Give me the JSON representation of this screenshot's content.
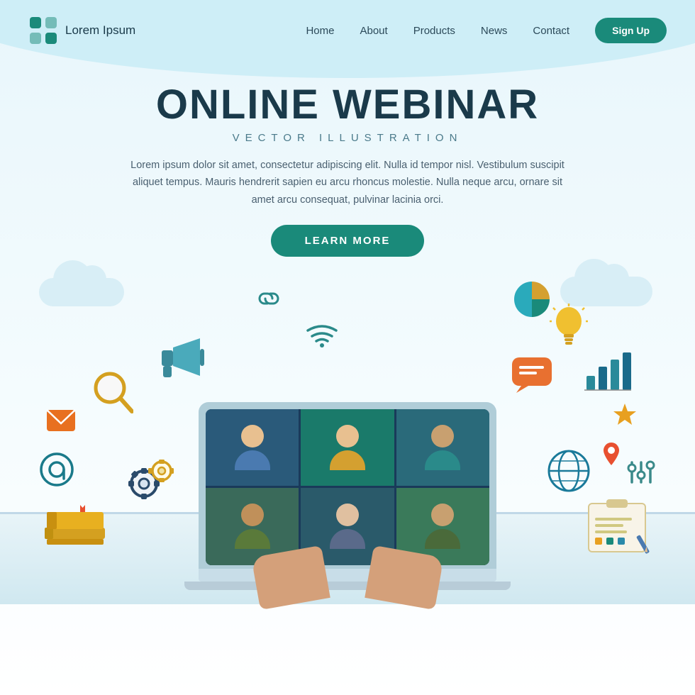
{
  "brand": {
    "logo_text": "Lorem Ipsum"
  },
  "nav": {
    "links": [
      {
        "label": "Home",
        "name": "nav-home"
      },
      {
        "label": "About",
        "name": "nav-about"
      },
      {
        "label": "Products",
        "name": "nav-products"
      },
      {
        "label": "News",
        "name": "nav-news"
      },
      {
        "label": "Contact",
        "name": "nav-contact"
      }
    ],
    "signup_label": "Sign Up"
  },
  "hero": {
    "title": "ONLINE WEBINAR",
    "subtitle": "VECTOR  ILLUSTRATION",
    "description": "Lorem ipsum dolor sit amet, consectetur adipiscing elit. Nulla id tempor nisl. Vestibulum suscipit aliquet tempus. Mauris hendrerit sapien eu arcu rhoncus molestie. Nulla neque arcu, ornare sit amet arcu consequat, pulvinar lacinia orci.",
    "cta_label": "LEARN MORE"
  }
}
